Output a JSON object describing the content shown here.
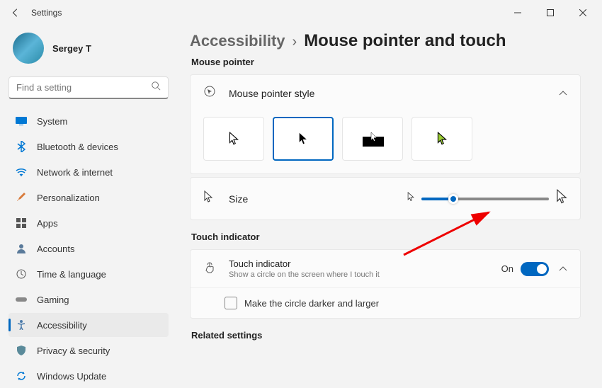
{
  "window": {
    "title": "Settings"
  },
  "user": {
    "name": "Sergey T"
  },
  "search": {
    "placeholder": "Find a setting"
  },
  "nav": {
    "system": "System",
    "bluetooth": "Bluetooth & devices",
    "network": "Network & internet",
    "personalization": "Personalization",
    "apps": "Apps",
    "accounts": "Accounts",
    "time": "Time & language",
    "gaming": "Gaming",
    "accessibility": "Accessibility",
    "privacy": "Privacy & security",
    "update": "Windows Update"
  },
  "breadcrumb": {
    "parent": "Accessibility",
    "current": "Mouse pointer and touch"
  },
  "sections": {
    "mouse_pointer": "Mouse pointer",
    "touch_indicator": "Touch indicator",
    "related": "Related settings"
  },
  "cards": {
    "style": {
      "title": "Mouse pointer style"
    },
    "size": {
      "title": "Size"
    },
    "touch": {
      "title": "Touch indicator",
      "subtitle": "Show a circle on the screen where I touch it",
      "toggle_label": "On",
      "checkbox_label": "Make the circle darker and larger"
    }
  }
}
